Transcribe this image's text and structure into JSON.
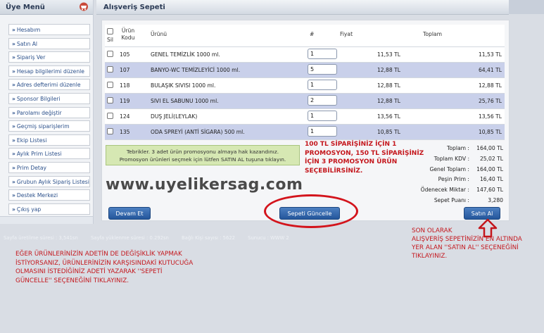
{
  "sidebar": {
    "title": "Üye Menü",
    "items": [
      {
        "label": "Hesabım"
      },
      {
        "label": "Satın Al"
      },
      {
        "label": "Sipariş Ver"
      },
      {
        "label": "Hesap bilgilerimi düzenle"
      },
      {
        "label": "Adres defterimi düzenle"
      },
      {
        "label": "Sponsor Bilgileri"
      },
      {
        "label": "Parolamı değiştir"
      },
      {
        "label": "Geçmiş siparişlerim"
      },
      {
        "label": "Ekip Listesi"
      },
      {
        "label": "Aylık Prim Listesi"
      },
      {
        "label": "Prim Detay"
      },
      {
        "label": "Grubun Aylık Sipariş Listesi"
      },
      {
        "label": "Destek Merkezi"
      },
      {
        "label": "Çıkış yap"
      }
    ],
    "arrow": "»"
  },
  "header": {
    "title": "Alışveriş Sepeti"
  },
  "table": {
    "headers": {
      "delete": "Sil",
      "code": "Ürün\nKodu",
      "product": "Ürünü",
      "qty": "#",
      "price": "Fiyat",
      "total": "Toplam"
    },
    "rows": [
      {
        "code": "105",
        "name": "GENEL TEMİZLİK 1000 ml.",
        "qty": "1",
        "price": "11,53 TL",
        "total": "11,53 TL"
      },
      {
        "code": "107",
        "name": "BANYO-WC TEMİZLEYİCİ 1000 ml.",
        "qty": "5",
        "price": "12,88 TL",
        "total": "64,41 TL"
      },
      {
        "code": "118",
        "name": "BULAŞIK SIVISI 1000 ml.",
        "qty": "1",
        "price": "12,88 TL",
        "total": "12,88 TL"
      },
      {
        "code": "119",
        "name": "SIVI EL SABUNU 1000 ml.",
        "qty": "2",
        "price": "12,88 TL",
        "total": "25,76 TL"
      },
      {
        "code": "124",
        "name": "DUŞ JELİ(LEYLAK)",
        "qty": "1",
        "price": "13,56 TL",
        "total": "13,56 TL"
      },
      {
        "code": "135",
        "name": "ODA SPREYİ (ANTİ SİGARA) 500 ml.",
        "qty": "1",
        "price": "10,85 TL",
        "total": "10,85 TL"
      }
    ]
  },
  "promo": {
    "line1": "Tebrikler. 3 adet ürün promosyonu almaya hak kazandınız.",
    "line2": "Promosyon ürünleri seçmek için lütfen SATIN AL tuşuna tıklayın."
  },
  "summary": [
    {
      "label": "Toplam :",
      "value": "164,00 TL"
    },
    {
      "label": "Toplam KDV :",
      "value": "25,02 TL"
    },
    {
      "label": "Genel Toplam :",
      "value": "164,00 TL"
    },
    {
      "label": "Peşin Prim :",
      "value": "16,40 TL"
    },
    {
      "label": "Ödenecek Miktar :",
      "value": "147,60 TL"
    },
    {
      "label": "Sepet Puanı :",
      "value": "3,280"
    }
  ],
  "buttons": {
    "continue": "Devam Et",
    "update": "Sepeti Güncelle",
    "buy": "Satın Al"
  },
  "annotations": {
    "promo_note": "100 TL SİPARİŞİNİZ İÇİN 1 PROMOSYON, 150 TL SİPARİŞİNİZ İÇİN 3 PROMOSYON ÜRÜN SEÇEBİLİRSİNİZ.",
    "promo_note_lines": [
      "100 TL SİPARİŞİNİZ İÇİN 1",
      "PROMOSYON, 150 TL SİPARİŞİNİZ",
      "İÇİN 3 PROMOSYON ÜRÜN",
      "SEÇEBİLİRSİNİZ."
    ],
    "watermark": "www.uyelikersag.com",
    "buy_note_lines": [
      "SON OLARAK",
      "ALIŞVERİŞ SEPETİNİZİN EN ALTINDA",
      "YER ALAN ''SATIN AL'' SEÇENEĞİNİ",
      "TIKLAYINIZ."
    ],
    "update_note_lines": [
      "EĞER ÜRÜNLERİNİZİN ADETİN DE DEĞİŞİKLİK YAPMAK",
      "İSTİYORSANIZ, ÜRÜNLERİNİZİN KARŞISINDAKİ KUTUCUĞA",
      "OLMASINI İSTEDİĞİNİZ ADETİ YAZARAK ''SEPETİ",
      "GÜNCELLE'' SEÇENEĞİNİ TIKLAYINIZ."
    ]
  },
  "footer": [
    "Sayfa üretilme süresi : 3,541sn",
    "Sayfa yüklenme süresi : 0.292sn",
    "Bağlı Kişi sayısı : 5622",
    "Sunucu : WWW 2"
  ],
  "colors": {
    "accent": "#24569b",
    "annotation": "#c4161c",
    "row_alt": "#c9d0ea",
    "promo_bg": "#d6e8b3"
  }
}
